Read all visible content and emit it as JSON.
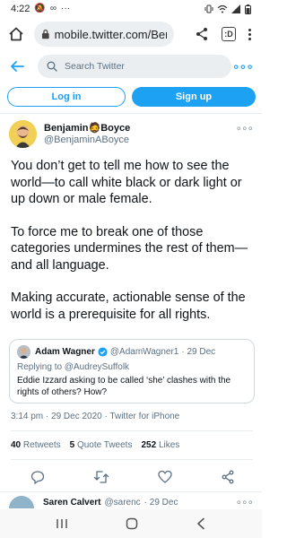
{
  "status_bar": {
    "time": "4:22",
    "left_icons": [
      "mute-icon",
      "voicemail-icon",
      "more-notifications-icon"
    ],
    "right_icons": [
      "vibrate-icon",
      "wifi-icon",
      "signal-icon",
      "battery-icon"
    ]
  },
  "browser": {
    "url": "mobile.twitter.com/Ben",
    "tab_count": ":D"
  },
  "header": {
    "search_placeholder": "Search Twitter"
  },
  "auth": {
    "login_label": "Log in",
    "signup_label": "Sign up"
  },
  "tweet": {
    "author_name": "Benjamin🧔Boyce",
    "author_handle": "@BenjaminABoyce",
    "paragraphs": [
      "You don’t get to tell me how to see the world—to call white black or dark light or up down or male female.",
      "To force me to break one of those categories undermines the rest of them—and all language.",
      "Making accurate, actionable sense of the world is a prerequisite for all rights."
    ],
    "timestamp": "3:14 pm · 29 Dec 2020 · Twitter for iPhone",
    "retweets_count": "40",
    "retweets_label": "Retweets",
    "quotes_count": "5",
    "quotes_label": "Quote Tweets",
    "likes_count": "252",
    "likes_label": "Likes"
  },
  "quote": {
    "name": "Adam Wagner",
    "handle": "@AdamWagner1",
    "date": "· 29 Dec",
    "replying_to": "Replying to @AudreySuffolk",
    "text": "Eddie Izzard asking to be called ‘she’ clashes with the rights of others? How?"
  },
  "reply_peek": {
    "name": "Saren Calvert",
    "handle": "@sarenc",
    "date": "· 29 Dec"
  },
  "colors": {
    "twitter_blue": "#1da1f2",
    "text_primary": "#0f1419",
    "text_secondary": "#5b7083",
    "divider": "#e6ecf0"
  }
}
